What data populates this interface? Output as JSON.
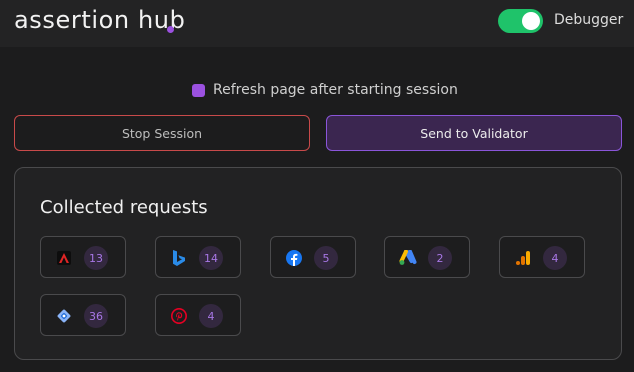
{
  "header": {
    "logo_text": "assertion hub",
    "debugger_label": "Debugger",
    "debugger_enabled": true
  },
  "session": {
    "refresh_label": "Refresh page after starting session",
    "refresh_checked": true,
    "stop_label": "Stop Session",
    "send_label": "Send to Validator"
  },
  "requests": {
    "title": "Collected requests",
    "items": [
      {
        "icon": "adobe-icon",
        "count": "13"
      },
      {
        "icon": "bing-icon",
        "count": "14"
      },
      {
        "icon": "facebook-icon",
        "count": "5"
      },
      {
        "icon": "google-ads-icon",
        "count": "2"
      },
      {
        "icon": "google-analytics-icon",
        "count": "4"
      },
      {
        "icon": "google-tag-manager-icon",
        "count": "36"
      },
      {
        "icon": "pinterest-icon",
        "count": "4"
      }
    ]
  },
  "colors": {
    "accent": "#9b51e0",
    "toggle_on": "#1fc36a",
    "stop_border": "#c84a4a",
    "send_bg": "#3b2650"
  }
}
